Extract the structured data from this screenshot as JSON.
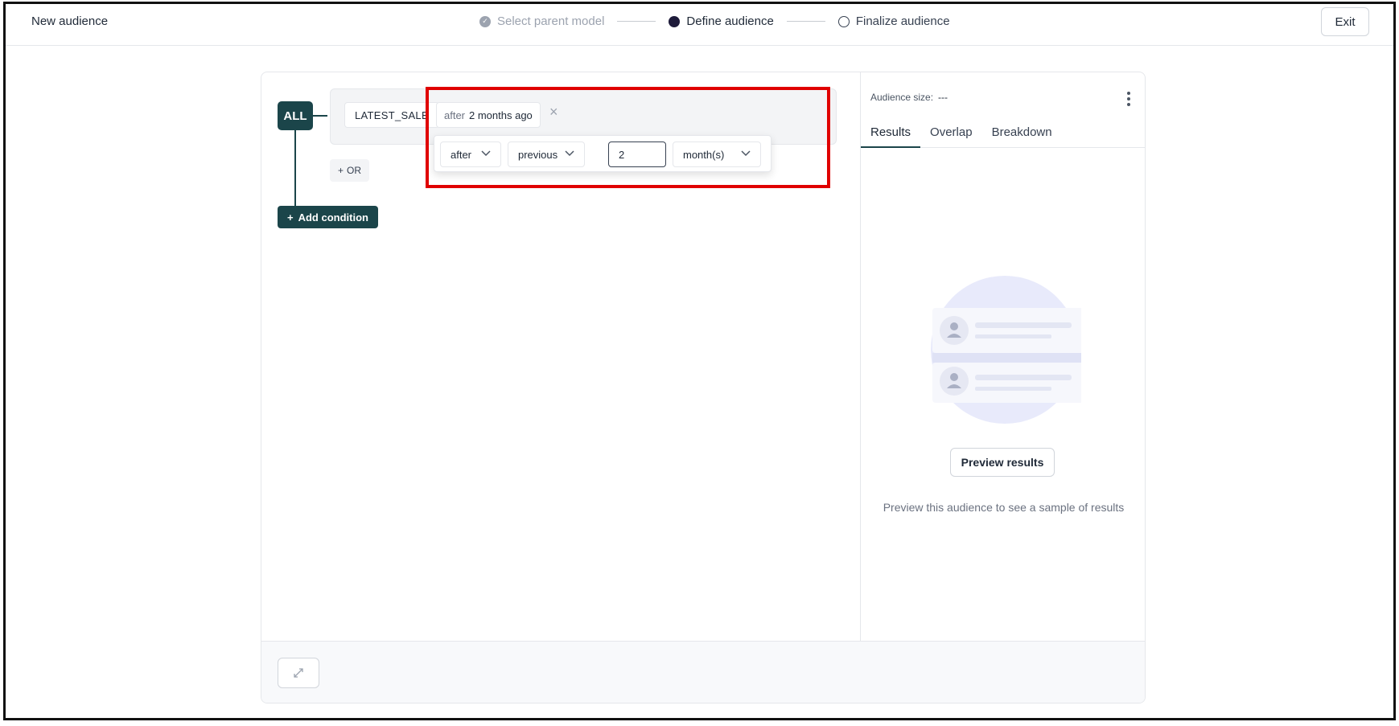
{
  "header": {
    "title": "New audience",
    "steps": [
      {
        "label": "Select parent model",
        "state": "done"
      },
      {
        "label": "Define audience",
        "state": "active"
      },
      {
        "label": "Finalize audience",
        "state": "pending"
      }
    ],
    "exit_label": "Exit"
  },
  "builder": {
    "root_operator": "ALL",
    "condition": {
      "property": "LATEST_SALE",
      "operator_text": "after",
      "value_text": "2 months ago"
    },
    "popover": {
      "operator": "after",
      "direction": "previous",
      "amount": "2",
      "unit": "month(s)"
    },
    "or_label": "OR",
    "add_condition_label": "Add condition"
  },
  "sidebar": {
    "size_label": "Audience size:",
    "size_value": "---",
    "tabs": [
      "Results",
      "Overlap",
      "Breakdown"
    ],
    "active_tab": "Results",
    "preview_button": "Preview results",
    "preview_hint": "Preview this audience to see a sample of results"
  },
  "colors": {
    "accent": "#1b454a",
    "highlight": "#e00000",
    "illustration": "#e8eafb"
  }
}
